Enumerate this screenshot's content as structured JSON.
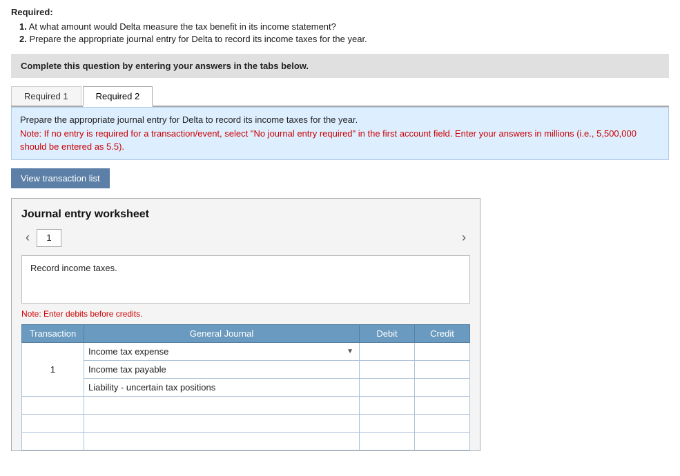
{
  "required_header": "Required:",
  "required_items": [
    {
      "num": "1.",
      "text": "At what amount would Delta measure the tax benefit in its income statement?"
    },
    {
      "num": "2.",
      "text": "Prepare the appropriate journal entry for Delta to record its income taxes for the year."
    }
  ],
  "instruction_box": "Complete this question by entering your answers in the tabs below.",
  "tabs": [
    {
      "label": "Required 1",
      "active": false
    },
    {
      "label": "Required 2",
      "active": true
    }
  ],
  "note_main": "Prepare the appropriate journal entry for Delta to record its income taxes for the year.",
  "note_red": "Note: If no entry is required for a transaction/event, select \"No journal entry required\" in the first account field. Enter your answers in millions (i.e., 5,500,000 should be entered as 5.5).",
  "view_transaction_btn": "View transaction list",
  "worksheet": {
    "title": "Journal entry worksheet",
    "nav_number": "1",
    "record_text": "Record income taxes.",
    "note_debits": "Note: Enter debits before credits.",
    "table": {
      "headers": [
        "Transaction",
        "General Journal",
        "Debit",
        "Credit"
      ],
      "rows": [
        {
          "transaction": "1",
          "accounts": [
            {
              "label": "Income tax expense",
              "has_dropdown": true
            },
            {
              "label": "Income tax payable",
              "has_dropdown": false
            },
            {
              "label": "Liability - uncertain tax positions",
              "has_dropdown": false
            }
          ]
        },
        {
          "transaction": "",
          "accounts": [],
          "empty": true
        },
        {
          "transaction": "",
          "accounts": [],
          "empty": true
        },
        {
          "transaction": "",
          "accounts": [],
          "empty": true
        }
      ]
    }
  }
}
